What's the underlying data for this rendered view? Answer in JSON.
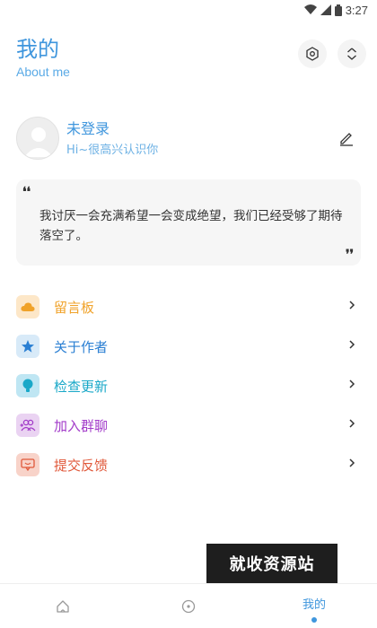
{
  "status": {
    "time": "3:27"
  },
  "header": {
    "title": "我的",
    "subtitle": "About me"
  },
  "profile": {
    "name": "未登录",
    "greeting": "Hi~很高兴认识你"
  },
  "quote": {
    "open_mark": "❛❛",
    "close_mark": "❜❜",
    "text": "我讨厌一会充满希望一会变成绝望，我们已经受够了期待落空了。"
  },
  "menu": {
    "items": [
      {
        "label": "留言板",
        "icon": "cloud-icon",
        "color": "#f0a229",
        "bg": "#fde7c8"
      },
      {
        "label": "关于作者",
        "icon": "star-icon",
        "color": "#2a7fd3",
        "bg": "#d8eaf8"
      },
      {
        "label": "检查更新",
        "icon": "bulb-icon",
        "color": "#19a8c8",
        "bg": "#bfe6f3"
      },
      {
        "label": "加入群聊",
        "icon": "group-icon",
        "color": "#a23bc9",
        "bg": "#ead3f2"
      },
      {
        "label": "提交反馈",
        "icon": "feedback-icon",
        "color": "#e0583a",
        "bg": "#f8d3c9"
      }
    ]
  },
  "watermark": "就收资源站",
  "bottom_nav": {
    "items": [
      {
        "label": "",
        "icon": "home-icon"
      },
      {
        "label": "",
        "icon": "compass-icon"
      },
      {
        "label": "我的",
        "icon": "",
        "active": true
      }
    ]
  },
  "colors": {
    "accent": "#3f96dd"
  }
}
